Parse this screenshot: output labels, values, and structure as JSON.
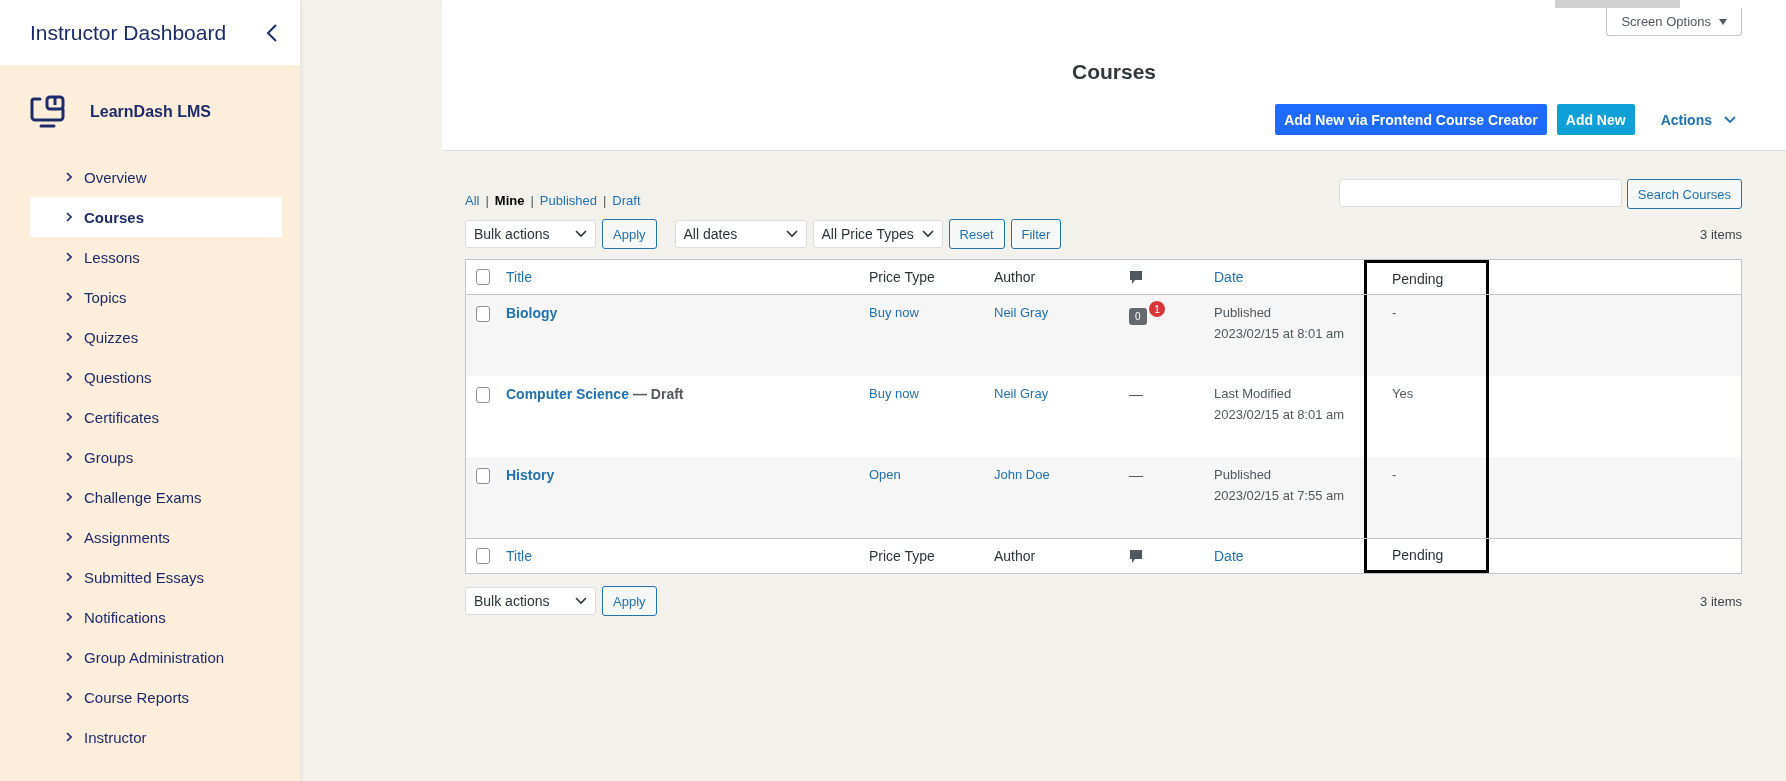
{
  "sidebar": {
    "title": "Instructor Dashboard",
    "brand": "LearnDash LMS",
    "items": [
      {
        "label": "Overview",
        "selected": false
      },
      {
        "label": "Courses",
        "selected": true
      },
      {
        "label": "Lessons",
        "selected": false
      },
      {
        "label": "Topics",
        "selected": false
      },
      {
        "label": "Quizzes",
        "selected": false
      },
      {
        "label": "Questions",
        "selected": false
      },
      {
        "label": "Certificates",
        "selected": false
      },
      {
        "label": "Groups",
        "selected": false
      },
      {
        "label": "Challenge Exams",
        "selected": false
      },
      {
        "label": "Assignments",
        "selected": false
      },
      {
        "label": "Submitted Essays",
        "selected": false
      },
      {
        "label": "Notifications",
        "selected": false
      },
      {
        "label": "Group Administration",
        "selected": false
      },
      {
        "label": "Course Reports",
        "selected": false
      },
      {
        "label": "Instructor",
        "selected": false
      }
    ]
  },
  "header": {
    "screen_options": "Screen Options",
    "title": "Courses",
    "frontend_button": "Add New via Frontend Course Creator",
    "add_new_button": "Add New",
    "actions": "Actions"
  },
  "views": [
    {
      "label": "All",
      "separator": "|",
      "selected": false
    },
    {
      "label": "Mine",
      "separator": "|",
      "selected": true
    },
    {
      "label": "Published",
      "separator": "|",
      "selected": false
    },
    {
      "label": "Draft",
      "selected": false
    }
  ],
  "search": {
    "button": "Search Courses"
  },
  "filters": {
    "bulk_actions": "Bulk actions",
    "apply": "Apply",
    "dates": "All dates",
    "price_types": "All Price Types",
    "reset": "Reset",
    "filter": "Filter",
    "items_count": "3 items"
  },
  "table": {
    "select_all_checked": false,
    "columns": [
      {
        "label": "Title",
        "kind": "sortable",
        "highlighted": false
      },
      {
        "label": "Price Type",
        "kind": "text",
        "highlighted": false
      },
      {
        "label": "Author",
        "kind": "text",
        "highlighted": false
      },
      {
        "kind": "comment-icon",
        "highlighted": false
      },
      {
        "label": "Date",
        "kind": "sortable",
        "highlighted": false
      },
      {
        "label": "Pending",
        "kind": "text",
        "highlighted": true
      }
    ],
    "footer_columns": [
      {
        "label": "Title",
        "kind": "sortable",
        "highlighted": false
      },
      {
        "label": "Price Type",
        "kind": "text",
        "highlighted": false
      },
      {
        "label": "Author",
        "kind": "text",
        "highlighted": false
      },
      {
        "kind": "comment-icon",
        "highlighted": false
      },
      {
        "label": "Date",
        "kind": "sortable",
        "highlighted": false
      },
      {
        "label": "Pending",
        "kind": "text",
        "highlighted": true
      }
    ],
    "rows": [
      {
        "checked": false,
        "title": "Biology",
        "price_type": "Buy now",
        "author": "Neil Gray",
        "comments": {
          "kind": "bubble",
          "count": "0",
          "pending": "1"
        },
        "date_status": "Published",
        "date": "2023/02/15 at 8:01 am",
        "pending": "-"
      },
      {
        "checked": false,
        "title": "Computer Science",
        "state": "— Draft",
        "price_type": "Buy now",
        "author": "Neil Gray",
        "comments": {
          "kind": "dash",
          "text": "—"
        },
        "date_status": "Last Modified",
        "date": "2023/02/15 at 8:01 am",
        "pending": "Yes"
      },
      {
        "checked": false,
        "title": "History",
        "price_type": "Open",
        "author": "John Doe",
        "comments": {
          "kind": "dash",
          "text": "—"
        },
        "date_status": "Published",
        "date": "2023/02/15 at 7:55 am",
        "pending": "-"
      }
    ],
    "footer_select_all_checked": false
  },
  "bottom": {
    "bulk_actions": "Bulk actions",
    "apply": "Apply",
    "items_count": "3 items"
  }
}
